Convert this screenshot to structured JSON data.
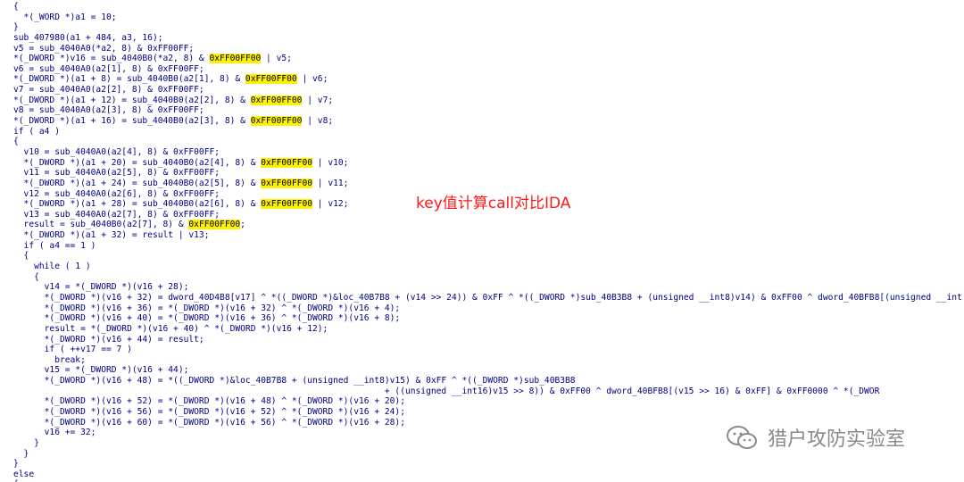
{
  "code_lines": [
    "{",
    "  *(_WORD *)a1 = 10;",
    "}",
    "sub_407980(a1 + 484, a3, 16);",
    "v5 = sub_4040A0(*a2, 8) & 0xFF00FF;",
    "*(_DWORD *)v16 = sub_4040B0(*a2, 8) & [[0xFF00FF00]] | v5;",
    "v6 = sub_4040A0(a2[1], 8) & 0xFF00FF;",
    "*(_DWORD *)(a1 + 8) = sub_4040B0(a2[1], 8) & [[0xFF00FF00]] | v6;",
    "v7 = sub_4040A0(a2[2], 8) & 0xFF00FF;",
    "*(_DWORD *)(a1 + 12) = sub_4040B0(a2[2], 8) & [[0xFF00FF00]] | v7;",
    "v8 = sub_4040A0(a2[3], 8) & 0xFF00FF;",
    "*(_DWORD *)(a1 + 16) = sub_4040B0(a2[3], 8) & [[0xFF00FF00]] | v8;",
    "if ( a4 )",
    "{",
    "  v10 = sub_4040A0(a2[4], 8) & 0xFF00FF;",
    "  *(_DWORD *)(a1 + 20) = sub_4040B0(a2[4], 8) & [[0xFF00FF00]] | v10;",
    "  v11 = sub_4040A0(a2[5], 8) & 0xFF00FF;",
    "  *(_DWORD *)(a1 + 24) = sub_4040B0(a2[5], 8) & [[0xFF00FF00]] | v11;",
    "  v12 = sub_4040A0(a2[6], 8) & 0xFF00FF;",
    "  *(_DWORD *)(a1 + 28) = sub_4040B0(a2[6], 8) & [[0xFF00FF00]] | v12;",
    "  v13 = sub_4040A0(a2[7], 8) & 0xFF00FF;",
    "  result = sub_4040B0(a2[7], 8) & [[0xFF00FF00]];",
    "  *(_DWORD *)(a1 + 32) = result | v13;",
    "  if ( a4 == 1 )",
    "  {",
    "    while ( 1 )",
    "    {",
    "      v14 = *(_DWORD *)(v16 + 28);",
    "      *(_DWORD *)(v16 + 32) = dword_40D4B8[v17] ^ *((_DWORD *)&loc_40B7B8 + (v14 >> 24)) & 0xFF ^ *((_DWORD *)sub_40B3B8 + (unsigned __int8)v14) & 0xFF00 ^ dword_40BFB8[(unsigned __int",
    "      *(_DWORD *)(v16 + 36) = *(_DWORD *)(v16 + 32) ^ *(_DWORD *)(v16 + 4);",
    "      *(_DWORD *)(v16 + 40) = *(_DWORD *)(v16 + 36) ^ *(_DWORD *)(v16 + 8);",
    "      result = *(_DWORD *)(v16 + 40) ^ *(_DWORD *)(v16 + 12);",
    "      *(_DWORD *)(v16 + 44) = result;",
    "      if ( ++v17 == 7 )",
    "        break;",
    "      v15 = *(_DWORD *)(v16 + 44);",
    "      *(_DWORD *)(v16 + 48) = *((_DWORD *)&loc_40B7B8 + (unsigned __int8)v15) & 0xFF ^ *((_DWORD *)sub_40B3B8",
    "                                                                        + ((unsigned __int16)v15 >> 8)) & 0xFF00 ^ dword_40BFB8[(v15 >> 16) & 0xFF] & 0xFF0000 ^ *(_DWOR",
    "      *(_DWORD *)(v16 + 52) = *(_DWORD *)(v16 + 48) ^ *(_DWORD *)(v16 + 20);",
    "      *(_DWORD *)(v16 + 56) = *(_DWORD *)(v16 + 52) ^ *(_DWORD *)(v16 + 24);",
    "      *(_DWORD *)(v16 + 60) = *(_DWORD *)(v16 + 56) ^ *(_DWORD *)(v16 + 28);",
    "      v16 += 32;",
    "    }",
    "  }",
    "}",
    "else",
    "{"
  ],
  "annotation": "key值计算call对比IDA",
  "watermark": {
    "icon": "wechat-icon",
    "text": "猎户攻防实验室"
  },
  "colors": {
    "code_text": "#000080",
    "highlight": "#fff200",
    "annotation": "#ff1a1a",
    "watermark": "#8a8a8a"
  }
}
